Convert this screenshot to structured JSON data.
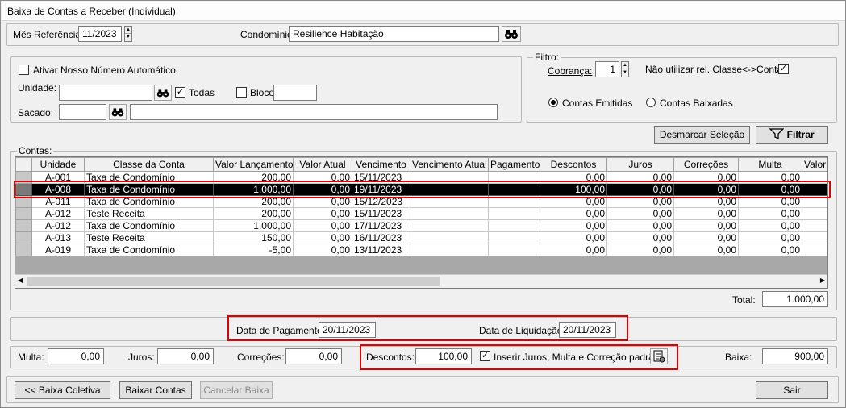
{
  "window": {
    "title": "Baixa de Contas a Receber (Individual)"
  },
  "header": {
    "mes_label": "Mês Referência:",
    "mes_value": "11/2023",
    "condominio_label": "Condomínio:",
    "condominio_value": "Resilience Habitação"
  },
  "params": {
    "nosso_numero_label": "Ativar Nosso Número Automático",
    "unidade_label": "Unidade:",
    "todas_label": "Todas",
    "bloco_label": "Bloco",
    "sacado_label": "Sacado:"
  },
  "filtro": {
    "legend": "Filtro:",
    "cobranca_label": "Cobrança:",
    "cobranca_value": "1",
    "nao_utilizar_label": "Não utilizar rel. Classe<->Conta",
    "contas_emitidas_label": "Contas Emitidas",
    "contas_baixadas_label": "Contas Baixadas"
  },
  "actions": {
    "desmarcar_label": "Desmarcar Seleção",
    "filtrar_label": "Filtrar"
  },
  "contas": {
    "legend": "Contas:",
    "columns": [
      "Unidade",
      "Classe da Conta",
      "Valor Lançamento",
      "Valor Atual",
      "Vencimento",
      "Vencimento Atual",
      "Pagamento",
      "Descontos",
      "Juros",
      "Correções",
      "Multa",
      "Valor"
    ],
    "rows": [
      {
        "unidade": "A-001",
        "classe": "Taxa de Condomínio",
        "valor_lanc": "200,00",
        "valor_atual": "0,00",
        "vencimento": "15/11/2023",
        "venc_atual": "",
        "pagamento": "",
        "descontos": "0,00",
        "juros": "0,00",
        "correcoes": "0,00",
        "multa": "0,00",
        "valor": ""
      },
      {
        "unidade": "A-008",
        "classe": "Taxa de Condomínio",
        "valor_lanc": "1.000,00",
        "valor_atual": "0,00",
        "vencimento": "19/11/2023",
        "venc_atual": "",
        "pagamento": "",
        "descontos": "100,00",
        "juros": "0,00",
        "correcoes": "0,00",
        "multa": "0,00",
        "valor": ""
      },
      {
        "unidade": "A-011",
        "classe": "Taxa de Condomínio",
        "valor_lanc": "200,00",
        "valor_atual": "0,00",
        "vencimento": "15/12/2023",
        "venc_atual": "",
        "pagamento": "",
        "descontos": "0,00",
        "juros": "0,00",
        "correcoes": "0,00",
        "multa": "0,00",
        "valor": ""
      },
      {
        "unidade": "A-012",
        "classe": "Teste Receita",
        "valor_lanc": "200,00",
        "valor_atual": "0,00",
        "vencimento": "15/11/2023",
        "venc_atual": "",
        "pagamento": "",
        "descontos": "0,00",
        "juros": "0,00",
        "correcoes": "0,00",
        "multa": "0,00",
        "valor": ""
      },
      {
        "unidade": "A-012",
        "classe": "Taxa de Condomínio",
        "valor_lanc": "1.000,00",
        "valor_atual": "0,00",
        "vencimento": "17/11/2023",
        "venc_atual": "",
        "pagamento": "",
        "descontos": "0,00",
        "juros": "0,00",
        "correcoes": "0,00",
        "multa": "0,00",
        "valor": ""
      },
      {
        "unidade": "A-013",
        "classe": "Teste Receita",
        "valor_lanc": "150,00",
        "valor_atual": "0,00",
        "vencimento": "16/11/2023",
        "venc_atual": "",
        "pagamento": "",
        "descontos": "0,00",
        "juros": "0,00",
        "correcoes": "0,00",
        "multa": "0,00",
        "valor": ""
      },
      {
        "unidade": "A-019",
        "classe": "Taxa de Condomínio",
        "valor_lanc": "-5,00",
        "valor_atual": "0,00",
        "vencimento": "13/11/2023",
        "venc_atual": "",
        "pagamento": "",
        "descontos": "0,00",
        "juros": "0,00",
        "correcoes": "0,00",
        "multa": "0,00",
        "valor": ""
      }
    ],
    "selected_row": 1,
    "total_label": "Total:",
    "total_value": "1.000,00"
  },
  "datas": {
    "pagamento_label": "Data de Pagamento:",
    "pagamento_value": "20/11/2023",
    "liquidacao_label": "Data de Liquidação:",
    "liquidacao_value": "20/11/2023"
  },
  "totais": {
    "multa_label": "Multa:",
    "multa_value": "0,00",
    "juros_label": "Juros:",
    "juros_value": "0,00",
    "correcoes_label": "Correções:",
    "correcoes_value": "0,00",
    "descontos_label": "Descontos:",
    "descontos_value": "100,00",
    "inserir_label": "Inserir Juros, Multa e Correção padrão",
    "baixa_label": "Baixa:",
    "baixa_value": "900,00"
  },
  "footer": {
    "baixa_coletiva_label": "<< Baixa Coletiva",
    "baixar_contas_label": "Baixar Contas",
    "cancelar_baixa_label": "Cancelar Baixa",
    "sair_label": "Sair"
  },
  "colors": {
    "highlight": "#e00000",
    "selected_row_bg": "#000000"
  },
  "icons": [
    "binoculars-icon",
    "funnel-icon",
    "settings-document-icon"
  ]
}
